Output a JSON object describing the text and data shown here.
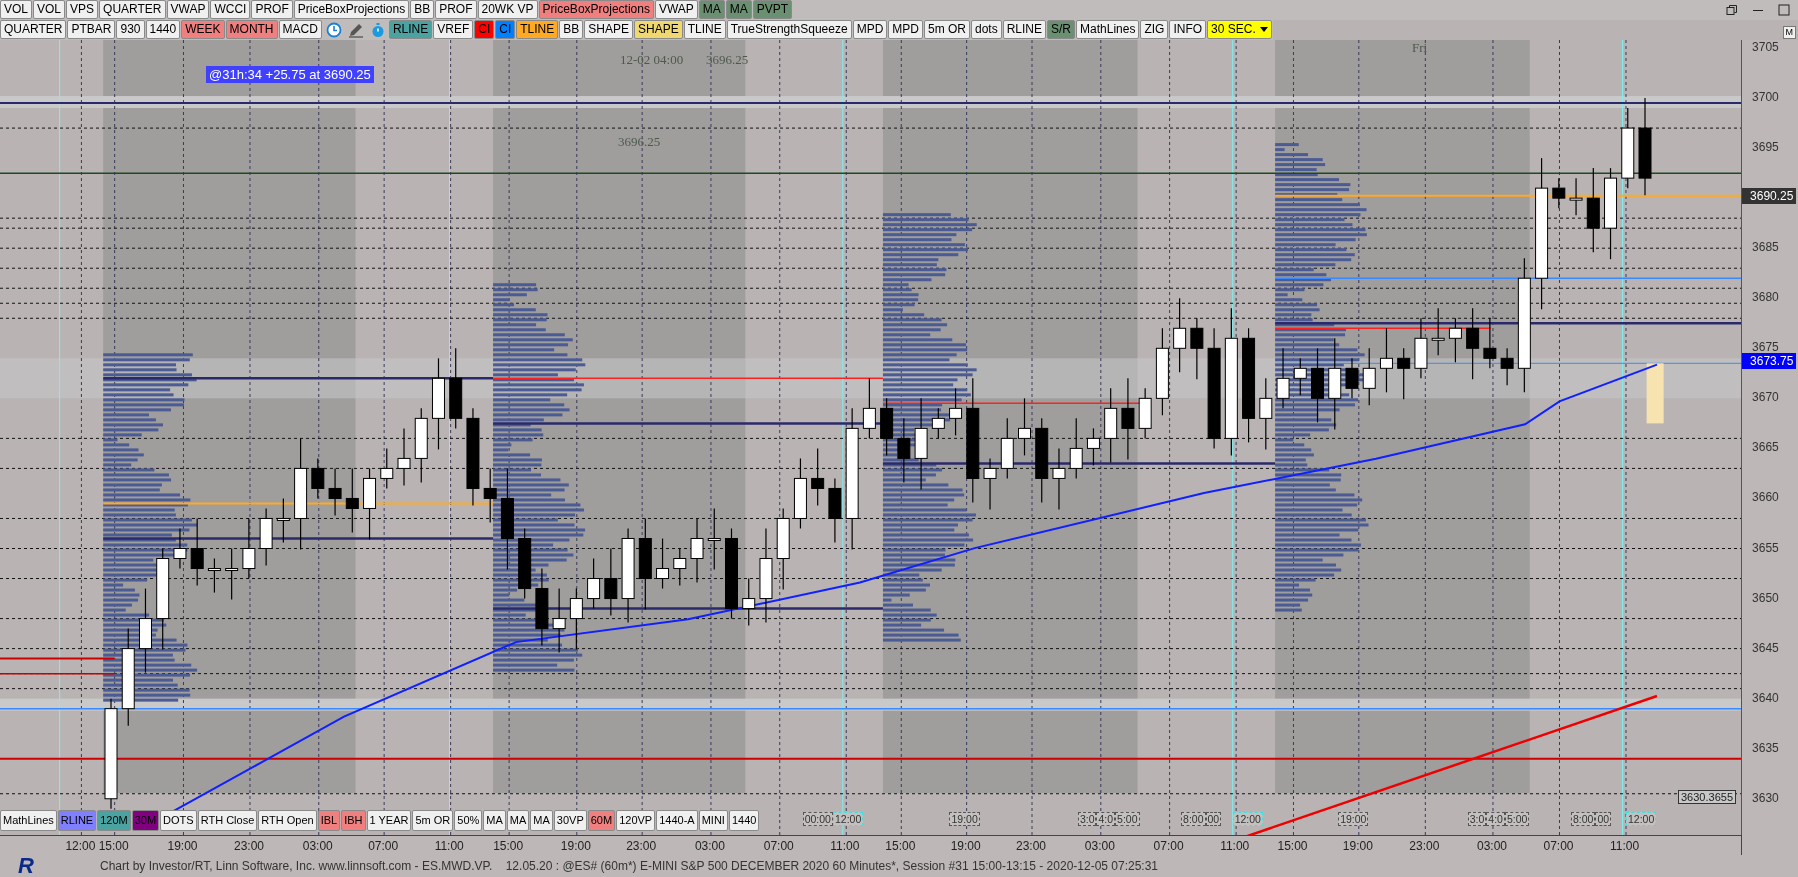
{
  "toolbar_top": [
    {
      "label": "VOL",
      "color": "#f0f0f0"
    },
    {
      "label": "VOL",
      "color": "#f0f0f0"
    },
    {
      "label": "VPS",
      "color": "#f0f0f0"
    },
    {
      "label": "QUARTER",
      "color": "#f0f0f0"
    },
    {
      "label": "VWAP",
      "color": "#f0f0f0"
    },
    {
      "label": "WCCI",
      "color": "#f0f0f0"
    },
    {
      "label": "PROF",
      "color": "#f0f0f0"
    },
    {
      "label": "PriceBoxProjections",
      "color": "#f0f0f0"
    },
    {
      "label": "BB",
      "color": "#f0f0f0"
    },
    {
      "label": "PROF",
      "color": "#f0f0f0"
    },
    {
      "label": "20WK VP",
      "color": "#f0f0f0"
    },
    {
      "label": "PriceBoxProjections",
      "color": "#f08080"
    },
    {
      "label": "VWAP",
      "color": "#f0f0f0"
    },
    {
      "label": "MA",
      "color": "#6b8f71"
    },
    {
      "label": "MA",
      "color": "#6b8f71"
    },
    {
      "label": "PVPT",
      "color": "#6b8f71"
    }
  ],
  "toolbar_second_left": [
    {
      "label": "QUARTER",
      "color": "#f0f0f0"
    },
    {
      "label": "PTBAR",
      "color": "#f0f0f0"
    },
    {
      "label": "930",
      "color": "#f0f0f0"
    },
    {
      "label": "1440",
      "color": "#f0f0f0"
    },
    {
      "label": "WEEK",
      "color": "#f08080"
    },
    {
      "label": "MONTH",
      "color": "#f08080"
    },
    {
      "label": "MACD",
      "color": "#f0f0f0"
    }
  ],
  "toolbar_second_right": [
    {
      "label": "RLINE",
      "color": "#4aa3a0",
      "kind": "button"
    },
    {
      "label": "VREF",
      "color": "#f0f0f0",
      "kind": "button"
    },
    {
      "label": "CI",
      "color": "#ff0000",
      "kind": "button"
    },
    {
      "label": "CI",
      "color": "#0080ff",
      "kind": "button"
    },
    {
      "label": "TLINE",
      "color": "#ffaa22",
      "kind": "button"
    },
    {
      "label": "BB",
      "color": "#f0f0f0",
      "kind": "button"
    },
    {
      "label": "SHAPE",
      "color": "#f0f0f0",
      "kind": "button"
    },
    {
      "label": "SHAPE",
      "color": "#f0d870",
      "kind": "button"
    },
    {
      "label": "TLINE",
      "color": "#f0f0f0",
      "kind": "button"
    },
    {
      "label": "TrueStrengthSqueeze",
      "color": "#f0f0f0",
      "kind": "button"
    },
    {
      "label": "MPD",
      "color": "#f0f0f0",
      "kind": "button"
    },
    {
      "label": "MPD",
      "color": "#f0f0f0",
      "kind": "button"
    },
    {
      "label": "5m OR",
      "color": "#f0f0f0",
      "kind": "button"
    },
    {
      "label": "dots",
      "color": "#f0f0f0",
      "kind": "button"
    },
    {
      "label": "RLINE",
      "color": "#f0f0f0",
      "kind": "button"
    },
    {
      "label": "S/R",
      "color": "#6b8f71",
      "kind": "button"
    },
    {
      "label": "MathLines",
      "color": "#f0f0f0",
      "kind": "button"
    },
    {
      "label": "ZIG",
      "color": "#f0f0f0",
      "kind": "button"
    },
    {
      "label": "INFO",
      "color": "#f0f0f0",
      "kind": "button"
    },
    {
      "label": "30 SEC.",
      "color": "#ffff00",
      "kind": "dropdown"
    }
  ],
  "chart": {
    "annotation": "@31h:34  +25.75 at 3690.25",
    "texts": [
      "12-02 04:00",
      "3696.25",
      "3696.25",
      "Fri"
    ],
    "price_ticks": [
      "3705",
      "3700",
      "3695",
      "3685",
      "3680",
      "3675",
      "3670",
      "3665",
      "3660",
      "3655",
      "3650",
      "3645",
      "3640",
      "3635",
      "3630"
    ],
    "last_price": "3690.25",
    "ma_price": "3673.75",
    "corner_value": "3630.3655",
    "corner_button": "M",
    "session_marks": [
      {
        "labels": [
          {
            "text": "00:00",
            "color": "#555555"
          },
          {
            "text": "12:00",
            "color": "#40e0e0"
          }
        ]
      },
      {
        "labels": [
          {
            "text": "19:00",
            "color": "#555555"
          }
        ]
      },
      {
        "labels": [
          {
            "text": "3:0",
            "color": "#555555"
          },
          {
            "text": "4:0",
            "color": "#555555"
          },
          {
            "text": "5:00",
            "color": "#555555"
          }
        ]
      },
      {
        "labels": [
          {
            "text": "8:00",
            "color": "#555555"
          },
          {
            "text": "00",
            "color": "#555555"
          }
        ]
      },
      {
        "labels": [
          {
            "text": "12:00",
            "color": "#40e0e0"
          }
        ]
      },
      {
        "labels": [
          {
            "text": "19:00",
            "color": "#555555"
          }
        ]
      },
      {
        "labels": [
          {
            "text": "3:0",
            "color": "#555555"
          },
          {
            "text": "4:0",
            "color": "#555555"
          },
          {
            "text": "5:00",
            "color": "#555555"
          }
        ]
      },
      {
        "labels": [
          {
            "text": "8:00",
            "color": "#555555"
          },
          {
            "text": "00",
            "color": "#555555"
          }
        ]
      },
      {
        "labels": [
          {
            "text": "12:00",
            "color": "#40e0e0"
          }
        ]
      }
    ]
  },
  "toolbar_bottom": [
    {
      "label": "MathLines",
      "color": "#f0f0f0"
    },
    {
      "label": "RLINE",
      "color": "#8080ff"
    },
    {
      "label": "120M",
      "color": "#4aa3a0"
    },
    {
      "label": "30M",
      "color": "#800080"
    },
    {
      "label": "DOTS",
      "color": "#f0f0f0"
    },
    {
      "label": "RTH Close",
      "color": "#f0f0f0"
    },
    {
      "label": "RTH Open",
      "color": "#f0f0f0"
    },
    {
      "label": "IBL",
      "color": "#f08080"
    },
    {
      "label": "IBH",
      "color": "#f08080"
    },
    {
      "label": "1 YEAR",
      "color": "#f0f0f0"
    },
    {
      "label": "5m OR",
      "color": "#f0f0f0"
    },
    {
      "label": "50%",
      "color": "#f0f0f0"
    },
    {
      "label": "MA",
      "color": "#f0f0f0"
    },
    {
      "label": "MA",
      "color": "#f0f0f0"
    },
    {
      "label": "MA",
      "color": "#f0f0f0"
    },
    {
      "label": "30VP",
      "color": "#f0f0f0"
    },
    {
      "label": "60M",
      "color": "#f08080"
    },
    {
      "label": "120VP",
      "color": "#f0f0f0"
    },
    {
      "label": "1440-A",
      "color": "#f0f0f0"
    },
    {
      "label": "MINI",
      "color": "#f0f0f0"
    },
    {
      "label": "1440",
      "color": "#f0f0f0"
    }
  ],
  "time_axis": [
    "12:00",
    "15:00",
    "19:00",
    "23:00",
    "03:00",
    "07:00",
    "11:00",
    "15:00",
    "19:00",
    "23:00",
    "03:00",
    "07:00",
    "11:00",
    "15:00",
    "19:00",
    "23:00",
    "03:00",
    "07:00",
    "11:00",
    "15:00",
    "19:00",
    "23:00",
    "03:00",
    "07:00",
    "11:00"
  ],
  "logo": "R",
  "status": "Chart by Investor/RT, Linn Software, Inc. www.linnsoft.com - ES.MWD.VP.    12.05.20 : @ES# (60m*) E-MINI S&P 500 DECEMBER 2020 60 Minutes*, Session #31 15:00-13:15 - 2020-12-05 07:25:31"
}
